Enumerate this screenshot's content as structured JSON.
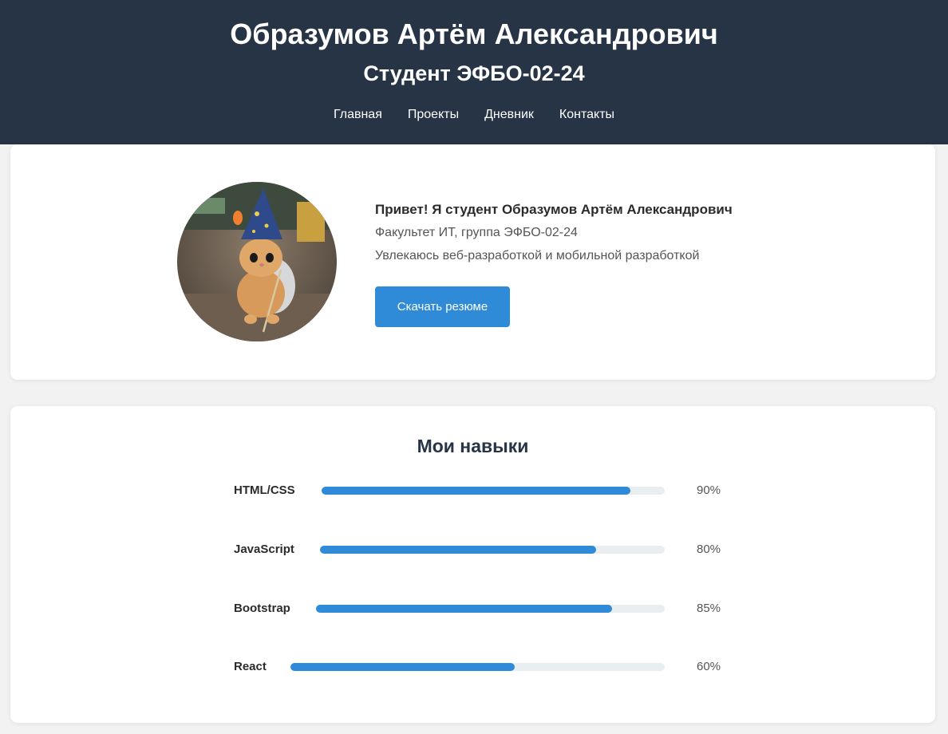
{
  "header": {
    "title": "Образумов Артём Александрович",
    "subtitle": "Студент ЭФБО-02-24",
    "nav": [
      {
        "label": "Главная"
      },
      {
        "label": "Проекты"
      },
      {
        "label": "Дневник"
      },
      {
        "label": "Контакты"
      }
    ]
  },
  "about": {
    "avatar_icon": "kitten-wizard-photo",
    "greeting": "Привет! Я студент Образумов Артём Александрович",
    "faculty": "Факультет ИТ, группа ЭФБО-02-24",
    "interests": "Увлекаюсь веб-разработкой и мобильной разработкой",
    "download_label": "Скачать резюме"
  },
  "skills": {
    "title": "Мои навыки",
    "items": [
      {
        "name": "HTML/CSS",
        "percent": "90%",
        "level": 0.9
      },
      {
        "name": "JavaScript",
        "percent": "80%",
        "level": 0.8
      },
      {
        "name": "Bootstrap",
        "percent": "85%",
        "level": 0.85
      },
      {
        "name": "React",
        "percent": "60%",
        "level": 0.6
      }
    ]
  },
  "colors": {
    "header_bg": "#263446",
    "accent": "#2f8ad8",
    "track": "#e9eef1",
    "page_bg": "#f2f2f2"
  }
}
